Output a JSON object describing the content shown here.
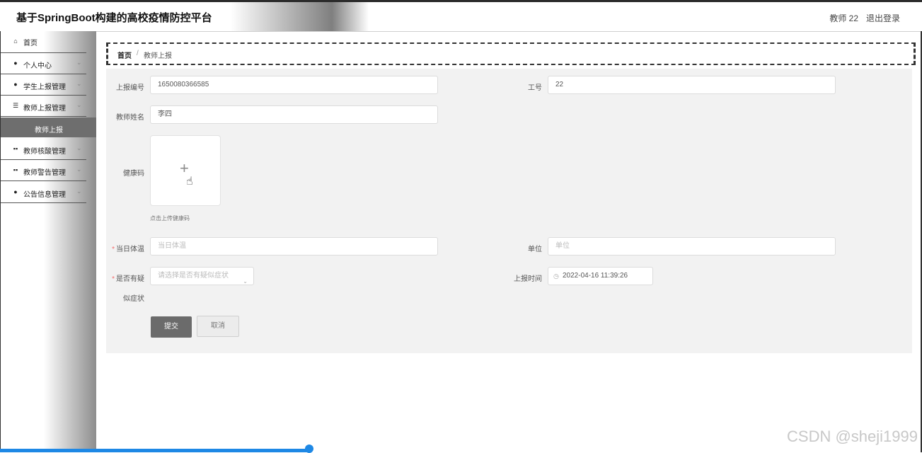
{
  "header": {
    "title": "基于SpringBoot构建的高校疫情防控平台",
    "user": "教师 22",
    "logout": "退出登录"
  },
  "sidebar": {
    "items": [
      {
        "icon": "home-icon",
        "glyph": "⌂",
        "label": "首页",
        "chevron": ""
      },
      {
        "icon": "user-icon",
        "glyph": "●",
        "label": "个人中心",
        "chevron": "⌄"
      },
      {
        "icon": "location-icon",
        "glyph": "●",
        "label": "学生上报管理",
        "chevron": "⌄"
      },
      {
        "icon": "sliders-icon",
        "glyph": "☰",
        "label": "教师上报管理",
        "chevron": "⌄"
      },
      {
        "icon": "grid-icon",
        "glyph": "▪▪",
        "label": "教师核酸管理",
        "chevron": "⌄"
      },
      {
        "icon": "grid-icon",
        "glyph": "▪▪",
        "label": "教师警告管理",
        "chevron": "⌄"
      },
      {
        "icon": "user-icon",
        "glyph": "●",
        "label": "公告信息管理",
        "chevron": "⌄"
      }
    ],
    "submenu_label": "教师上报"
  },
  "breadcrumb": {
    "home": "首页",
    "separator": "/",
    "current": "教师上报"
  },
  "form": {
    "report_no": {
      "label": "上报编号",
      "value": "1650080366585"
    },
    "job_no": {
      "label": "工号",
      "value": "22"
    },
    "teacher_name": {
      "label": "教师姓名",
      "value": "李四"
    },
    "health_code": {
      "label": "健康码",
      "hint": "点击上传健康码"
    },
    "temperature": {
      "label": "当日体温",
      "placeholder": "当日体温"
    },
    "unit": {
      "label": "单位",
      "placeholder": "单位"
    },
    "symptoms": {
      "label_line1": "是否有疑",
      "label_line2": "似症状",
      "placeholder": "请选择是否有疑似症状"
    },
    "report_time": {
      "label": "上报时间",
      "value": "2022-04-16 11:39:26"
    },
    "submit": "提交",
    "cancel": "取消"
  },
  "watermark": "CSDN @sheji1999"
}
